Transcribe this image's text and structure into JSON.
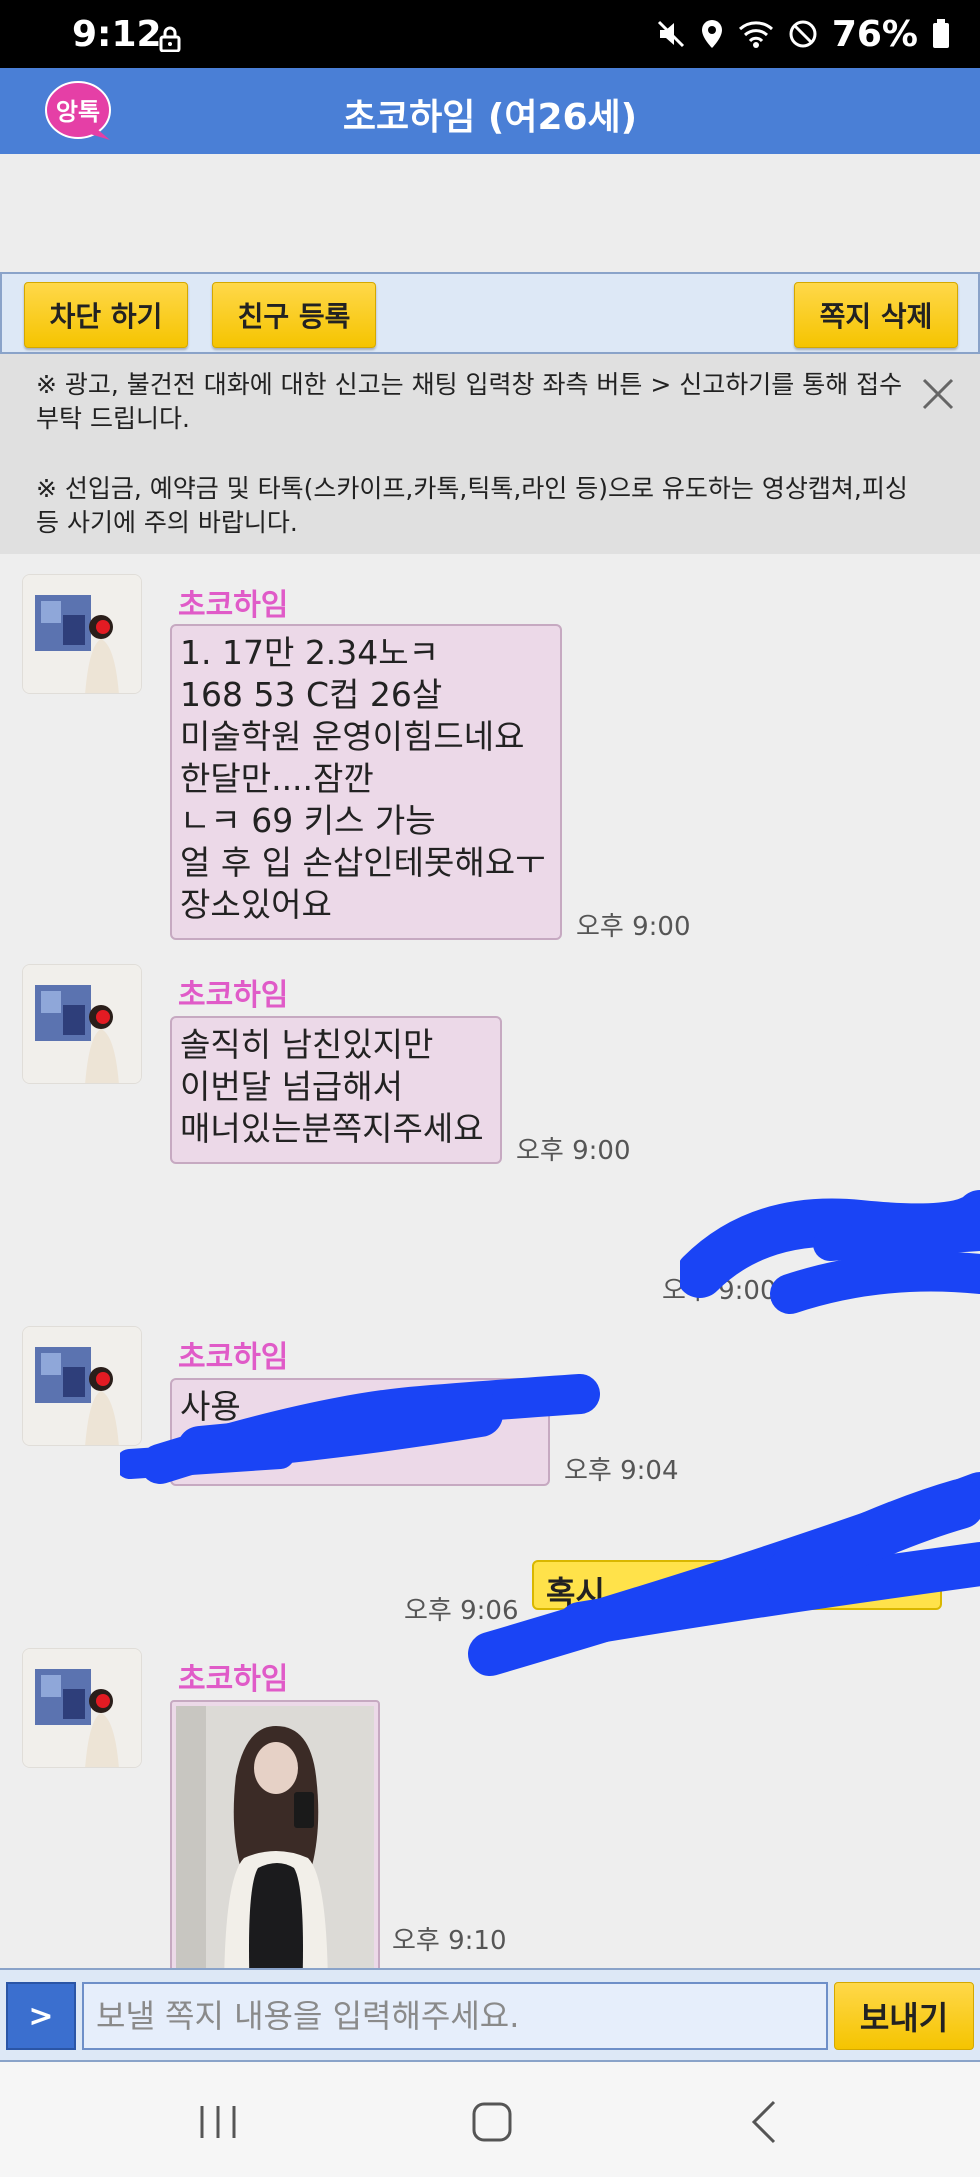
{
  "status_bar": {
    "time": "9:12",
    "battery": "76%"
  },
  "header": {
    "logo_text": "앙톡",
    "title": "초코하임 (여26세)"
  },
  "actions": {
    "block": "차단 하기",
    "add_friend": "친구 등록",
    "delete": "쪽지 삭제"
  },
  "notice": {
    "line1": "※ 광고, 불건전 대화에 대한 신고는 채팅 입력창 좌측 버튼 > 신고하기를 통해 접수 부탁 드립니다.",
    "line2": "※ 선입금, 예약금 및 타톡(스카이프,카톡,틱톡,라인 등)으로 유도하는 영상캡쳐,피싱 등 사기에 주의 바랍니다."
  },
  "messages": [
    {
      "sender": "초코하임",
      "text": "1. 17만 2.34노ㅋ\n168 53 C컵 26살\n미술학원 운영이힘드네요\n한달만....잠깐\nㄴㅋ 69 키스 가능\n얼 후 입 손삽인테못해요ㅜ\n장소있어요",
      "time": "오후 9:00"
    },
    {
      "sender": "초코하임",
      "text": "솔직히 남친있지만\n이번달 넘급해서\n매너있는분쪽지주세요",
      "time": "오후 9:00"
    },
    {
      "time": "오후 9:00"
    },
    {
      "sender": "초코하임",
      "text": "사용",
      "time": "오후 9:04"
    },
    {
      "text": "혹시",
      "time": "오후 9:06"
    },
    {
      "sender": "초코하임",
      "time": "오후 9:10"
    }
  ],
  "input": {
    "menu_label": ">",
    "placeholder": "보낼 쪽지 내용을 입력해주세요.",
    "send_label": "보내기"
  },
  "colors": {
    "header": "#4a7fd6",
    "button": "#f5c400",
    "sender": "#e05bc8",
    "bubble_in": "#ecd9e8",
    "bubble_out": "#ffe24a",
    "scribble": "#1a44f5"
  },
  "icons": [
    "lock-icon",
    "mute-icon",
    "location-icon",
    "wifi-icon",
    "dnd-icon",
    "battery-icon",
    "close-icon",
    "recent-apps-icon",
    "home-icon",
    "back-icon"
  ]
}
